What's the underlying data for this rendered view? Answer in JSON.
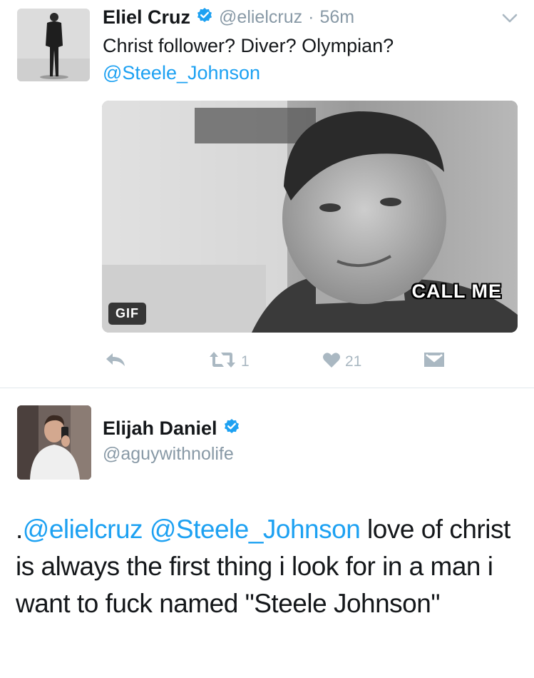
{
  "tweet1": {
    "author_name": "Eliel Cruz",
    "handle": "@elielcruz",
    "separator": "·",
    "time": "56m",
    "text_line1": "Christ follower? Diver? Olympian?",
    "mention": "@Steele_Johnson",
    "media": {
      "overlay_text": "CALL ME",
      "badge": "GIF"
    },
    "actions": {
      "retweet_count": "1",
      "like_count": "21"
    }
  },
  "tweet2": {
    "author_name": "Elijah Daniel",
    "handle": "@aguywithnolife",
    "text_prefix": ".",
    "mention1": "@elielcruz",
    "mention2": "@Steele_Johnson",
    "text_body": " love of christ is always the first thing i look for in a man i want to fuck named \"Steele Johnson\""
  },
  "colors": {
    "link": "#1da1f2",
    "muted": "#8899a6",
    "icon": "#aab8c2",
    "verified": "#1da1f2"
  },
  "icons": [
    "verified-badge-icon",
    "chevron-down-icon",
    "reply-icon",
    "retweet-icon",
    "heart-icon",
    "direct-message-icon"
  ]
}
